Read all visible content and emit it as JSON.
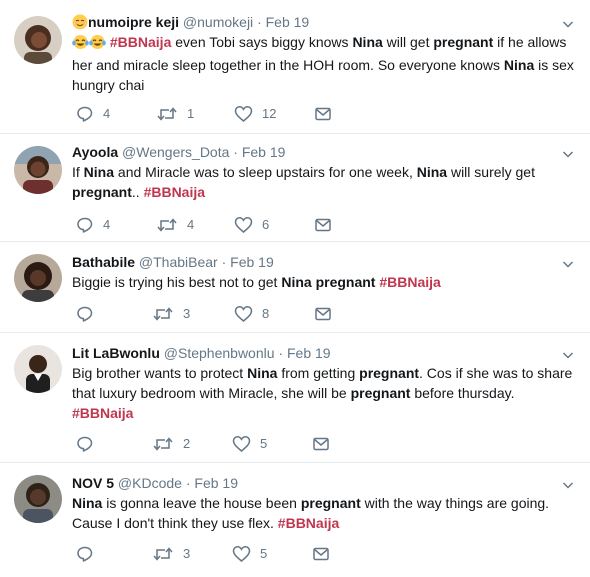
{
  "colors": {
    "hashtag": "#c0364f",
    "meta": "#657786",
    "divider": "#e6ecf0"
  },
  "tweets": [
    {
      "name": "numoipre keji",
      "handle": "@numokeji",
      "sep": "·",
      "time": "Feb 19",
      "name_emoji": "relieved-face",
      "lead_emojis": [
        "tears-of-joy",
        "tears-of-joy"
      ],
      "segments": [
        {
          "t": "#BBNaija",
          "s": "tag"
        },
        {
          "t": " even Tobi says biggy knows "
        },
        {
          "t": "Nina",
          "s": "b"
        },
        {
          "t": " will get "
        },
        {
          "t": "pregnant",
          "s": "b"
        },
        {
          "t": " if he allows her and miracle sleep together in the HOH room. So everyone knows "
        },
        {
          "t": "Nina",
          "s": "b"
        },
        {
          "t": " is sex hungry chai"
        }
      ],
      "replies": "4",
      "retweets": "1",
      "likes": "12"
    },
    {
      "name": "Ayoola",
      "handle": "@Wengers_Dota",
      "sep": "·",
      "time": "Feb 19",
      "segments": [
        {
          "t": "If "
        },
        {
          "t": "Nina",
          "s": "b"
        },
        {
          "t": " and Miracle was to sleep upstairs for one week, "
        },
        {
          "t": "Nina",
          "s": "b"
        },
        {
          "t": " will surely get "
        },
        {
          "t": "pregnant",
          "s": "b"
        },
        {
          "t": ".. "
        },
        {
          "t": "#BBNaija",
          "s": "tag"
        }
      ],
      "replies": "4",
      "retweets": "4",
      "likes": "6"
    },
    {
      "name": "Bathabile",
      "handle": "@ThabiBear",
      "sep": "·",
      "time": "Feb 19",
      "segments": [
        {
          "t": "Biggie is trying his best not to get "
        },
        {
          "t": "Nina",
          "s": "b"
        },
        {
          "t": " "
        },
        {
          "t": "pregnant",
          "s": "b"
        },
        {
          "t": " "
        },
        {
          "t": "#BBNaija",
          "s": "tag"
        }
      ],
      "replies": "",
      "retweets": "3",
      "likes": "8"
    },
    {
      "name": "Lit LaBwonlu",
      "handle": "@Stephenbwonlu",
      "sep": "·",
      "time": "Feb 19",
      "segments": [
        {
          "t": "Big brother wants to protect "
        },
        {
          "t": "Nina",
          "s": "b"
        },
        {
          "t": " from getting "
        },
        {
          "t": "pregnant",
          "s": "b"
        },
        {
          "t": ". Cos if she was to share that luxury bedroom with Miracle, she will be "
        },
        {
          "t": "pregnant",
          "s": "b"
        },
        {
          "t": " before thursday. "
        },
        {
          "t": "#BBNaija",
          "s": "tag"
        }
      ],
      "replies": "",
      "retweets": "2",
      "likes": "5"
    },
    {
      "name": "NOV 5",
      "handle": "@KDcode",
      "sep": "·",
      "time": "Feb 19",
      "segments": [
        {
          "t": "Nina",
          "s": "b"
        },
        {
          "t": " is gonna leave the house been "
        },
        {
          "t": "pregnant",
          "s": "b"
        },
        {
          "t": " with the way things are going. Cause I don't think they use flex.  "
        },
        {
          "t": "#BBNaija",
          "s": "tag"
        }
      ],
      "replies": "",
      "retweets": "3",
      "likes": "5"
    }
  ]
}
